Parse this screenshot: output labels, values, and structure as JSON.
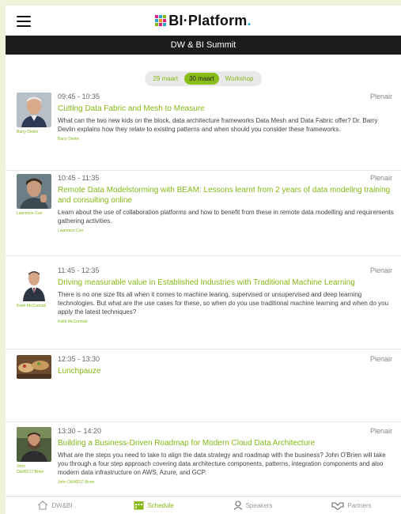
{
  "header": {
    "logo_text": "BI·Platform",
    "logo_dot": ".",
    "subtitle": "DW & BI Summit"
  },
  "tabs": [
    {
      "label": "29 maart",
      "active": false
    },
    {
      "label": "30 maart",
      "active": true
    },
    {
      "label": "Workshop",
      "active": false
    }
  ],
  "sessions": [
    {
      "time": "09:45 - 10:35",
      "room": "Plenair",
      "title": "Cutting Data Fabric and Mesh to Measure",
      "description": "What can the two new kids on the block, data architecture frameworks Data Mesh and Data Fabric offer? Dr. Barry Devlin explains how they relate to existing patterns and when should you consider these frameworks.",
      "speaker_caption": "Barry Devlin",
      "byline": "Barry Devlin"
    },
    {
      "time": "10:45 - 11:35",
      "room": "Plenair",
      "title": "Remote Data Modelstorming with BEAM: Lessons learnt from 2 years of data modeling training and consulting online",
      "description": "Learn about the use of collaboration platforms and how to benefit from these in remote data modelling and requirements gathering activities.",
      "speaker_caption": "Lawrence Corr",
      "byline": "Lawrence Corr"
    },
    {
      "time": "11:45 - 12:35",
      "room": "Plenair",
      "title": "Driving measurable value in Established Industries with Traditional Machine Learning",
      "description": "There is no one size fits all when it comes to machine learing, supervised or unsupervised and deep learning technologies. But what are the use cases for these, so when do you use traditional machine learning and when do you apply the latest techniques?",
      "speaker_caption": "Keith McCormick",
      "byline": "Keith McCormick"
    },
    {
      "time": "12:35 - 13:30",
      "room": "Plenair",
      "title": "Lunchpauze",
      "description": "",
      "speaker_caption": "",
      "byline": ""
    },
    {
      "time": "13:30 – 14:20",
      "room": "Plenair",
      "title": "Building a Business-Driven Roadmap for Modern Cloud Data Architecture",
      "description": "What are the steps you need to take to align the data strategy and roadmap with the business? John O'Brien will take you through a four step approach covering data architecture components, patterns, integration components and also modern data infrastructure on AWS, Azure, and GCP.",
      "speaker_caption": "John O&#8217;Brien",
      "byline": "John O&#8217;Brien"
    }
  ],
  "nav": [
    {
      "label": "DW&BI",
      "icon": "home-icon",
      "active": false
    },
    {
      "label": "Schedule",
      "icon": "calendar-icon",
      "active": true
    },
    {
      "label": "Speakers",
      "icon": "person-icon",
      "active": false
    },
    {
      "label": "Partners",
      "icon": "handshake-icon",
      "active": false
    }
  ],
  "colors": {
    "accent": "#86b817",
    "tab_active": "#8bbd1a",
    "logo_dot": "#2aa6c9",
    "subbar": "#1c1c1c"
  }
}
